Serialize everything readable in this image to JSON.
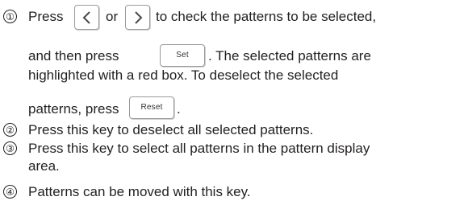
{
  "steps": [
    {
      "number": "①",
      "line1": {
        "press": "Press",
        "or": "or",
        "rest": "to check the patterns to be selected,"
      },
      "line2": {
        "before": "and then press",
        "after": ". The selected patterns are"
      },
      "line3": "highlighted with a red box. To deselect the selected",
      "line4": {
        "before": "patterns, press",
        "after": "."
      }
    },
    {
      "number": "②",
      "text": "Press this key to deselect all selected patterns."
    },
    {
      "number": "③",
      "line1": "Press this key to select all patterns in the pattern display",
      "line2": "area."
    },
    {
      "number": "④",
      "text": "Patterns can be moved with this key."
    }
  ],
  "buttons": {
    "prev_icon": "chevron-left-icon",
    "next_icon": "chevron-right-icon",
    "set_label": "Set",
    "reset_label": "Reset"
  }
}
